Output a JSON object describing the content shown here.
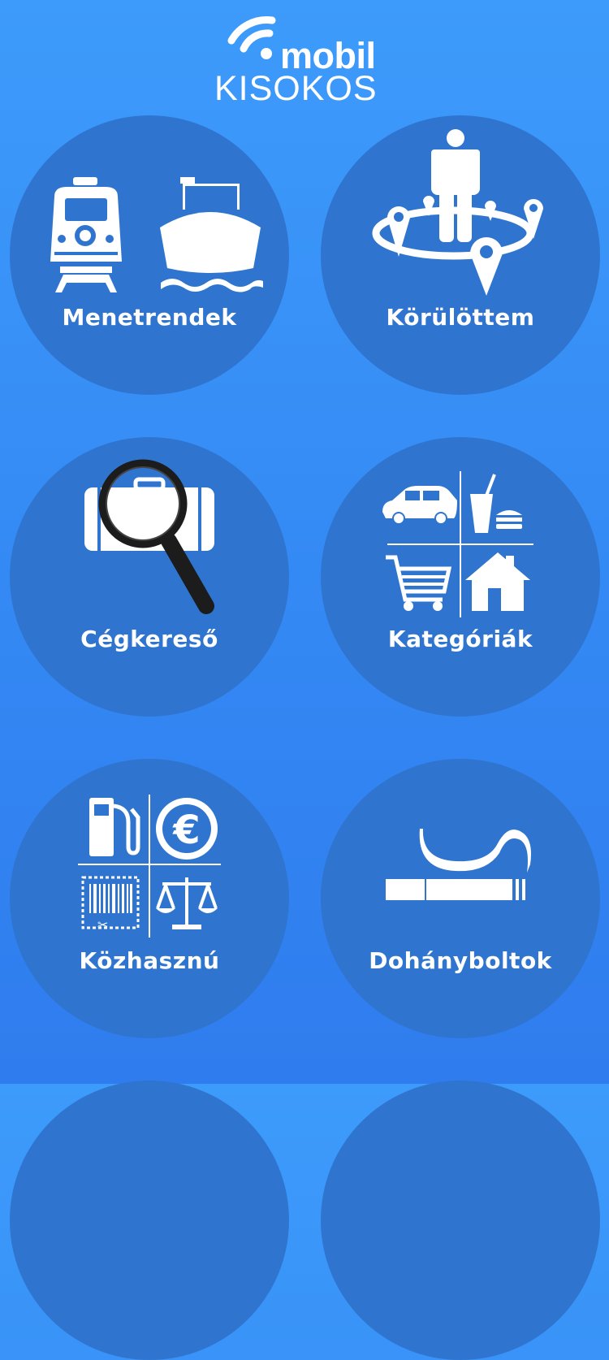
{
  "app": {
    "logo_top": "mobil",
    "logo_bottom": "KISOKOS"
  },
  "tiles": [
    {
      "label": "Menetrendek",
      "icon": "train-ship-icon"
    },
    {
      "label": "Körülöttem",
      "icon": "nearby-location-icon"
    },
    {
      "label": "Cégkereső",
      "icon": "company-search-icon"
    },
    {
      "label": "Kategóriák",
      "icon": "categories-icon"
    },
    {
      "label": "Közhasznú",
      "icon": "public-utility-icon"
    },
    {
      "label": "Dohányboltok",
      "icon": "tobacco-shop-icon"
    }
  ],
  "colors": {
    "background": "#3489f4",
    "tile": "#2f75cf",
    "text": "#ffffff"
  }
}
